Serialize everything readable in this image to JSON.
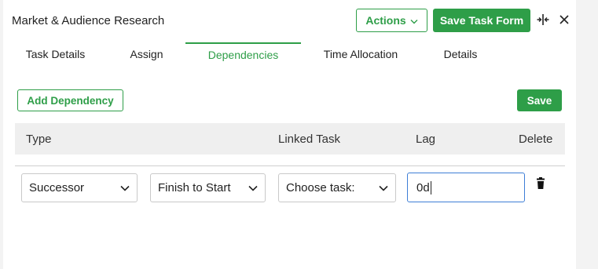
{
  "header": {
    "task_title": "Market & Audience Research",
    "actions_label": "Actions",
    "save_task_form_label": "Save Task Form"
  },
  "tabs": [
    {
      "label": "Task Details",
      "active": false
    },
    {
      "label": "Assign",
      "active": false
    },
    {
      "label": "Dependencies",
      "active": true
    },
    {
      "label": "Time Allocation",
      "active": false
    },
    {
      "label": "Details",
      "active": false
    }
  ],
  "toolbar": {
    "add_dependency_label": "Add Dependency",
    "save_label": "Save"
  },
  "table": {
    "columns": [
      "Type",
      "Linked Task",
      "Lag",
      "Delete"
    ],
    "rows": [
      {
        "type": "Successor",
        "dependency": "Finish to Start",
        "linked_task": "Choose task:",
        "lag": "0d"
      }
    ]
  },
  "colors": {
    "accent": "#2e9e48",
    "focus": "#3e7ed6"
  },
  "icons": [
    "chevron-down-icon",
    "split-view-icon",
    "close-icon",
    "trash-icon"
  ]
}
